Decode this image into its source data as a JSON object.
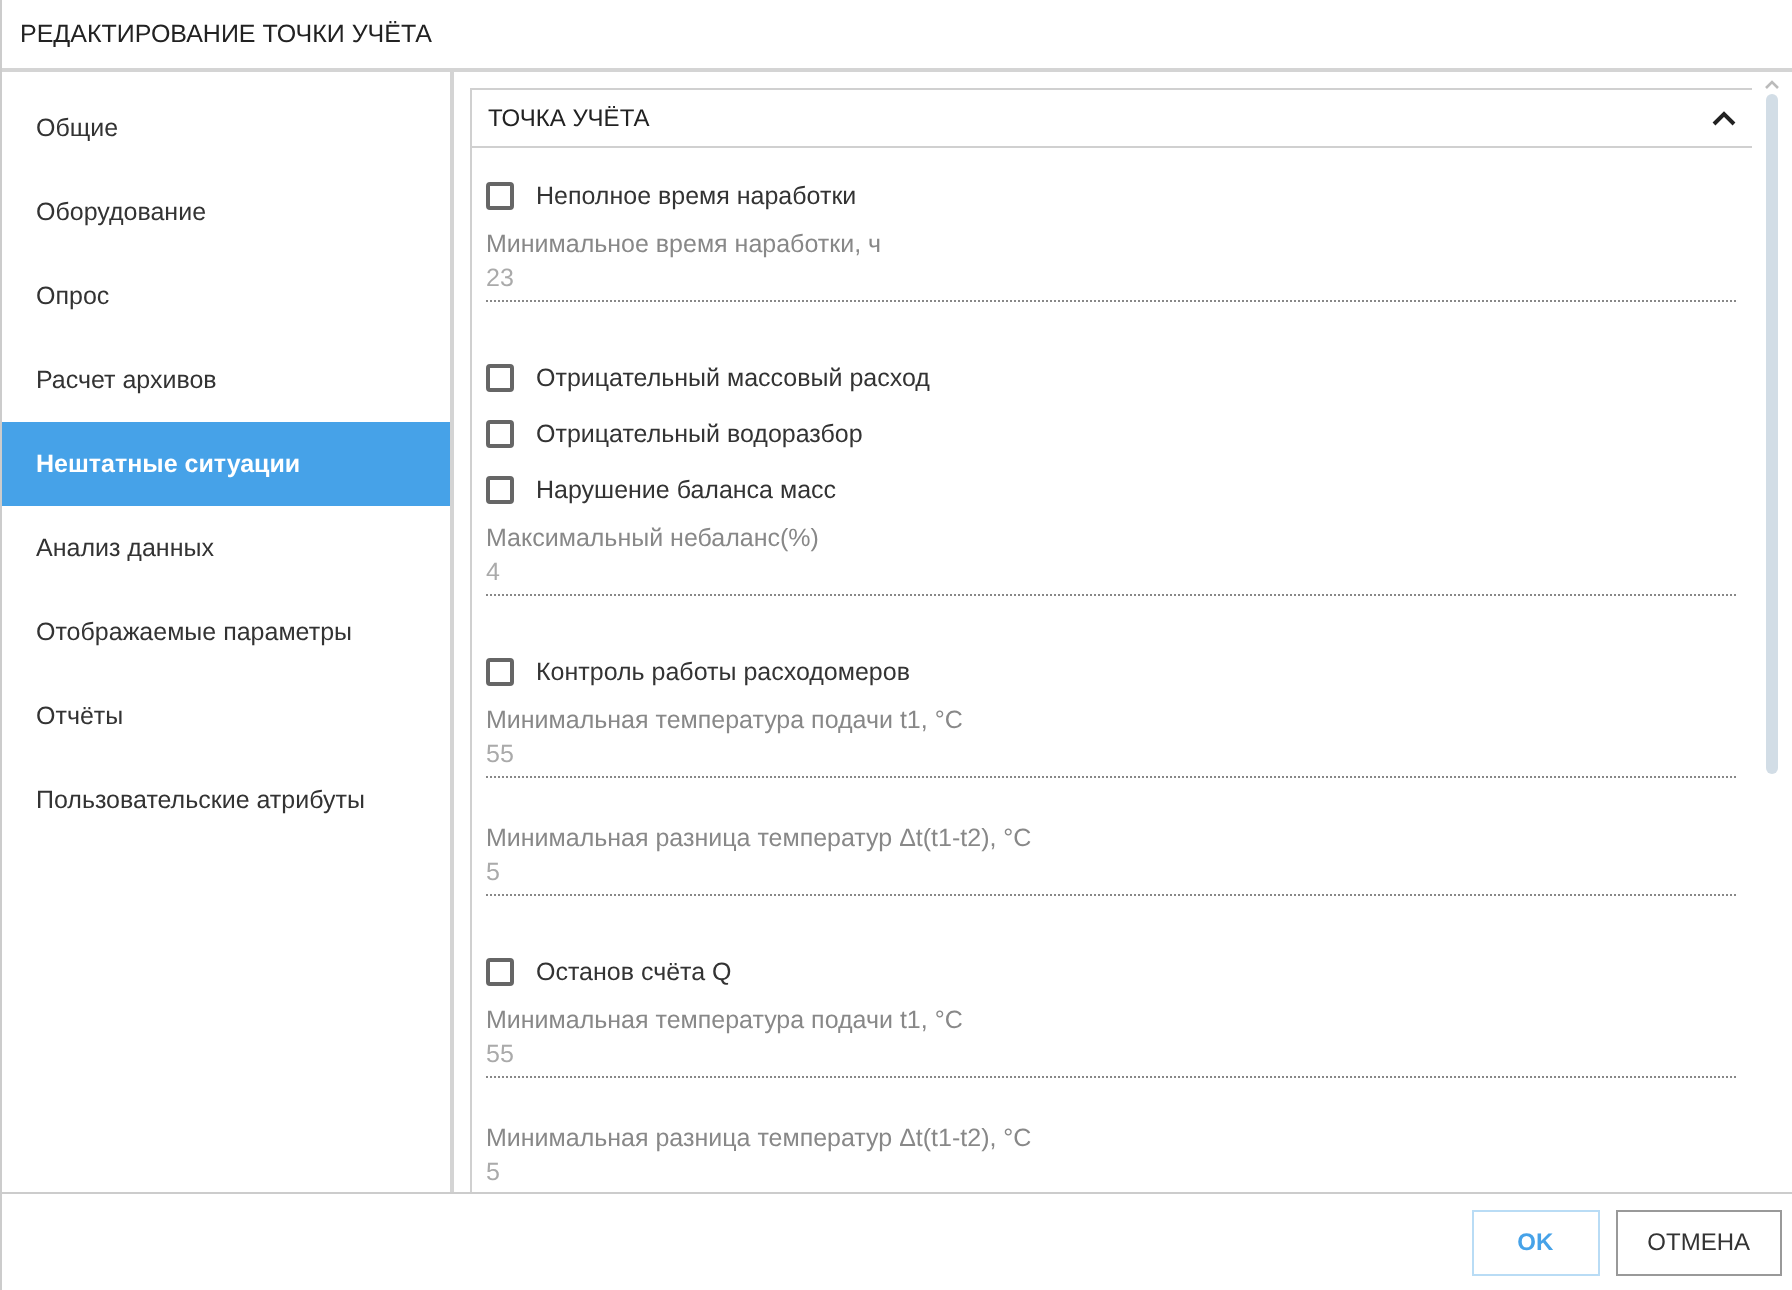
{
  "window": {
    "title": "РЕДАКТИРОВАНИЕ ТОЧКИ УЧЁТА"
  },
  "sidebar": {
    "items": [
      {
        "label": "Общие",
        "selected": false
      },
      {
        "label": "Оборудование",
        "selected": false
      },
      {
        "label": "Опрос",
        "selected": false
      },
      {
        "label": "Расчет архивов",
        "selected": false
      },
      {
        "label": "Нештатные ситуации",
        "selected": true
      },
      {
        "label": "Анализ данных",
        "selected": false
      },
      {
        "label": "Отображаемые параметры",
        "selected": false
      },
      {
        "label": "Отчёты",
        "selected": false
      },
      {
        "label": "Пользовательские атрибуты",
        "selected": false
      }
    ]
  },
  "panel": {
    "title": "ТОЧКА УЧЁТА",
    "expanded": true,
    "items": [
      {
        "kind": "checkbox",
        "label": "Неполное время наработки",
        "checked": false
      },
      {
        "kind": "field",
        "label": "Минимальное время наработки, ч",
        "value": "23"
      },
      {
        "kind": "checkbox",
        "label": "Отрицательный массовый расход",
        "checked": false
      },
      {
        "kind": "checkbox",
        "label": "Отрицательный водоразбор",
        "checked": false
      },
      {
        "kind": "checkbox",
        "label": "Нарушение баланса масс",
        "checked": false
      },
      {
        "kind": "field",
        "label": "Максимальный небаланс(%)",
        "value": "4"
      },
      {
        "kind": "checkbox",
        "label": "Контроль работы расходомеров",
        "checked": false
      },
      {
        "kind": "field",
        "label": "Минимальная температура подачи t1, °C",
        "value": "55"
      },
      {
        "kind": "field",
        "label": "Минимальная разница температур Δt(t1-t2), °C",
        "value": "5"
      },
      {
        "kind": "checkbox",
        "label": "Останов счёта Q",
        "checked": false
      },
      {
        "kind": "field",
        "label": "Минимальная температура подачи t1, °C",
        "value": "55"
      },
      {
        "kind": "field",
        "label": "Минимальная разница температур Δt(t1-t2), °C",
        "value": "5"
      }
    ]
  },
  "buttons": [
    {
      "label": "OK",
      "kind": "primary"
    },
    {
      "label": "ОТМЕНА",
      "kind": "secondary"
    }
  ]
}
